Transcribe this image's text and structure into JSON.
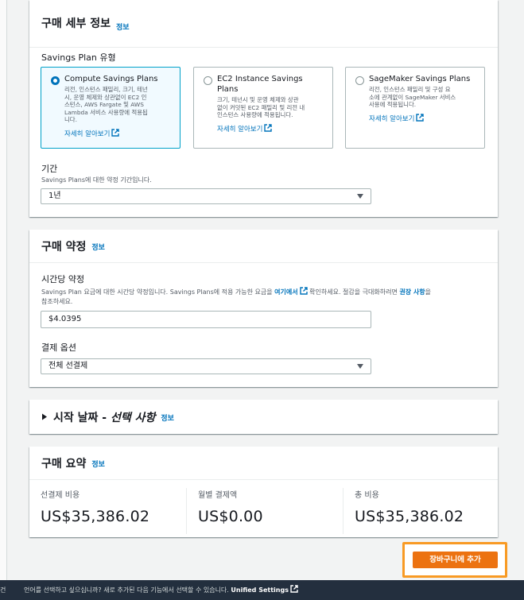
{
  "details": {
    "title": "구매 세부 정보",
    "info": "정보",
    "plan_type_label": "Savings Plan 유형",
    "cards": [
      {
        "title": "Compute Savings Plans",
        "desc": [
          "리전, 인스턴스 패밀리, 크기, 테넌",
          "시, 운영 체제와 상관없이 EC2 인",
          "스턴스, AWS Fargate 및 AWS",
          "Lambda 서비스 사용량에 적용됩",
          "니다."
        ],
        "link": "자세히 알아보기",
        "selected": true
      },
      {
        "title": "EC2 Instance Savings Plans",
        "desc": [
          "크기, 테넌시 및 운영 체제와 상관",
          "없이 커밋된 EC2 패밀리 및 리전 내",
          "인스턴스 사용량에 적용됩니다."
        ],
        "link": "자세히 알아보기",
        "selected": false
      },
      {
        "title": "SageMaker Savings Plans",
        "desc": [
          "리전, 인스턴스 패밀리 및 구성 요",
          "소에 관계없이 SageMaker 서비스",
          "사용에 적용됩니다."
        ],
        "link": "자세히 알아보기",
        "selected": false
      }
    ],
    "term_label": "기간",
    "term_desc": "Savings Plans에 대한 약정 기간입니다.",
    "term_value": "1년"
  },
  "commitment": {
    "title": "구매 약정",
    "info": "정보",
    "hourly_label": "시간당 약정",
    "hourly_desc_1": "Savings Plan 요금에 대한 시간당 약정입니다. Savings Plans에 적용 가능한 요금을 ",
    "hourly_desc_link1": "여기에서",
    "hourly_desc_2": " 확인하세요. 절감을 극대화하려면 ",
    "hourly_desc_link2": "권장 사항",
    "hourly_desc_3": "을",
    "hourly_desc_line2": "참조하세요.",
    "hourly_value": "$4.0395",
    "payment_label": "결제 옵션",
    "payment_value": "전체 선결제"
  },
  "start_date": {
    "title": "시작 날짜 - ",
    "title_italic": "선택 사항",
    "info": "정보"
  },
  "summary": {
    "title": "구매 요약",
    "info": "정보",
    "upfront_label": "선결제 비용",
    "upfront_value": "US$35,386.02",
    "monthly_label": "월별 결제액",
    "monthly_value": "US$0.00",
    "total_label": "총 비용",
    "total_value": "US$35,386.02"
  },
  "add_to_cart": "장바구니에 추가",
  "footer": {
    "left_fragment": "건",
    "message": "언어를 선택하고 싶으십니까? 새로 추가된 다음 기능에서 선택할 수 있습니다. ",
    "link": "Unified Settings"
  },
  "colors": {
    "link": "#0073bb",
    "primary": "#ec7211",
    "focus_ring": "#f89a24",
    "footer_bg": "#232f3e"
  }
}
